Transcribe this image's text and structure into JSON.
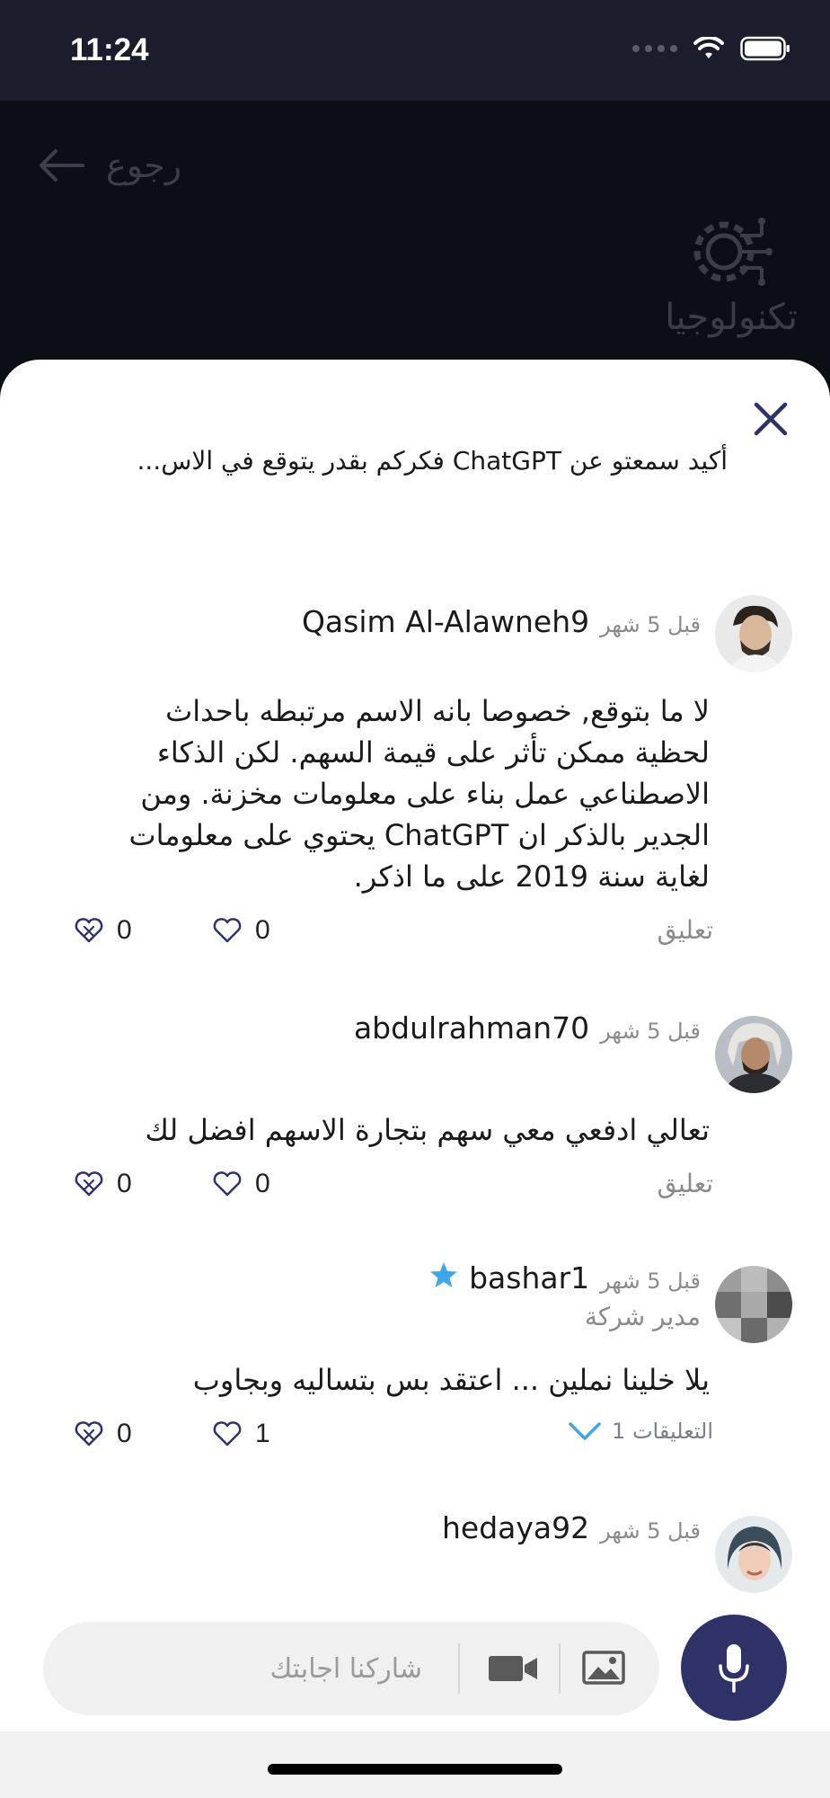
{
  "status_bar": {
    "time": "11:24"
  },
  "header": {
    "back_label": "رجوع",
    "category_label": "تكنولوجيا"
  },
  "post": {
    "title": "أكيد سمعتو عن ChatGPT فكركم بقدر يتوقع في الاس..."
  },
  "comments": [
    {
      "username": "Qasim Al-Alawneh9",
      "time_ago": "قبل 5 شهر",
      "lines": [
        "لا ما بتوقع, خصوصا بانه الاسم مرتبطه باحداث",
        "لحظية ممكن تأثر على قيمة السهم. لكن الذكاء",
        "الاصطناعي عمل بناء على معلومات مخزنة. ومن",
        "الجدير بالذكر ان ChatGPT يحتوي على معلومات",
        "لغاية سنة 2019 على ما اذكر."
      ],
      "reply_label": "تعليق",
      "likes": "0",
      "dislikes": "0"
    },
    {
      "username": "abdulrahman70",
      "time_ago": "قبل 5 شهر",
      "lines": [
        "تعالي ادفعي معي سهم بتجارة الاسهم افضل لك"
      ],
      "reply_label": "تعليق",
      "likes": "0",
      "dislikes": "0"
    },
    {
      "username": "bashar1",
      "time_ago": "قبل 5 شهر",
      "role": "مدير شركة",
      "lines": [
        "يلا خلينا نملين ... اعتقد بس بتساليه وبجاوب"
      ],
      "reply_label": "التعليقات 1",
      "likes": "1",
      "dislikes": "0"
    },
    {
      "username": "hedaya92",
      "time_ago": "قبل 5 شهر"
    }
  ],
  "composer": {
    "placeholder": "شاركنا اجابتك"
  },
  "colors": {
    "accent": "#2f3267",
    "star": "#3ea6ea",
    "reply_chevron": "#3ea6ea"
  },
  "icons": [
    "back-arrow-icon",
    "circuit-gear-icon",
    "close-icon",
    "heart-icon",
    "broken-heart-icon",
    "star-icon",
    "chevron-down-icon",
    "video-camera-icon",
    "image-icon",
    "microphone-icon"
  ]
}
